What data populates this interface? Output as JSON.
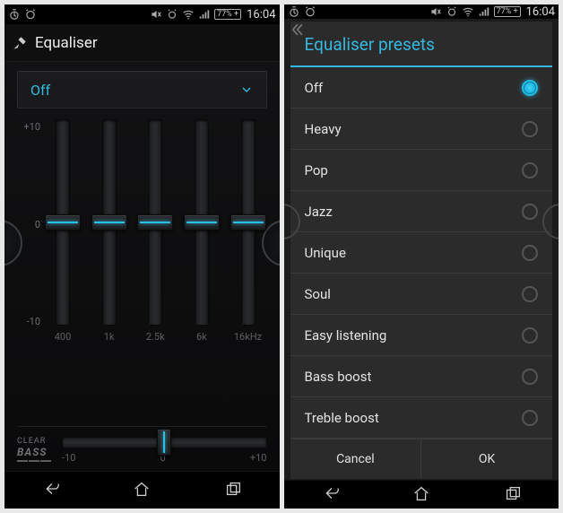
{
  "status": {
    "time": "16:04",
    "battery": "77%"
  },
  "screen1": {
    "title": "Equaliser",
    "preset_selected": "Off",
    "scale": {
      "max": "+10",
      "mid": "0",
      "min": "-10"
    },
    "bands": [
      {
        "freq": "400",
        "value": 0
      },
      {
        "freq": "1k",
        "value": 0
      },
      {
        "freq": "2.5k",
        "value": 0
      },
      {
        "freq": "6k",
        "value": 0
      },
      {
        "freq": "16kHz",
        "value": 0
      }
    ],
    "clearbass": {
      "label_top": "CLEAR",
      "label_bottom": "BASS",
      "scale_min": "-10",
      "scale_mid": "0",
      "scale_max": "+10",
      "value": 0
    }
  },
  "screen2": {
    "dialog_title": "Equaliser presets",
    "presets": [
      {
        "label": "Off",
        "selected": true
      },
      {
        "label": "Heavy",
        "selected": false
      },
      {
        "label": "Pop",
        "selected": false
      },
      {
        "label": "Jazz",
        "selected": false
      },
      {
        "label": "Unique",
        "selected": false
      },
      {
        "label": "Soul",
        "selected": false
      },
      {
        "label": "Easy listening",
        "selected": false
      },
      {
        "label": "Bass boost",
        "selected": false
      },
      {
        "label": "Treble boost",
        "selected": false
      }
    ],
    "cancel": "Cancel",
    "ok": "OK"
  }
}
